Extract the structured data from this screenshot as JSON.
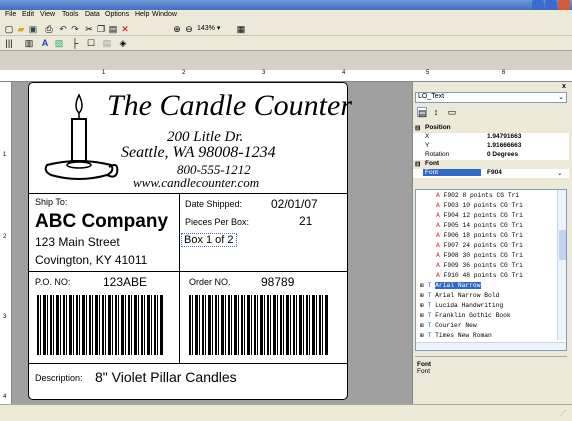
{
  "menu": [
    "File",
    "Edit",
    "View",
    "Tools",
    "Data",
    "Options",
    "Help",
    "Window"
  ],
  "toolbar": {
    "zoom": "143%"
  },
  "ruler": [
    "1",
    "2",
    "3",
    "4",
    "5",
    "6"
  ],
  "ruler_left": [
    "1",
    "2",
    "3",
    "4"
  ],
  "label": {
    "company_line1": "The Candle Counter",
    "address1": "200 Litle Dr.",
    "address2": "Seattle, WA 98008-1234",
    "phone": "800-555-1212",
    "website": "www.candlecounter.com",
    "ship_to_label": "Ship To:",
    "ship_company": "ABC Company",
    "ship_street": "123 Main Street",
    "ship_city": "Covington, KY 41011",
    "date_label": "Date Shipped:",
    "date_value": "02/01/07",
    "pieces_label": "Pieces Per Box:",
    "pieces_value": "21",
    "box_text": "Box 1 of 2",
    "po_label": "P.O. NO:",
    "po_value": "123ABE",
    "order_label": "Order NO.",
    "order_value": "98789",
    "desc_label": "Description:",
    "desc_value": "8\" Violet Pillar Candles"
  },
  "panel": {
    "object": "LO_Text",
    "close": "x",
    "section_position": "Position",
    "x_label": "X",
    "x_value": "1.94791663",
    "y_label": "Y",
    "y_value": "1.91666663",
    "rot_label": "Rotation",
    "rot_value": "0 Degrees",
    "section_font": "Font",
    "font_label": "Font",
    "font_value": "F904",
    "font_items": [
      {
        "code": "F902",
        "size": "8 points",
        "face": "CG Tri"
      },
      {
        "code": "F903",
        "size": "10 points",
        "face": "CG Tri"
      },
      {
        "code": "F904",
        "size": "12 points",
        "face": "CG Tri"
      },
      {
        "code": "F905",
        "size": "14 points",
        "face": "CG Tri"
      },
      {
        "code": "F906",
        "size": "18 points",
        "face": "CG Tri"
      },
      {
        "code": "F907",
        "size": "24 points",
        "face": "CG Tri"
      },
      {
        "code": "F908",
        "size": "30 points",
        "face": "CG Tri"
      },
      {
        "code": "F909",
        "size": "36 points",
        "face": "CG Tri"
      },
      {
        "code": "F910",
        "size": "48 points",
        "face": "CG Tri"
      }
    ],
    "families": [
      "Arial Narrow",
      "Arial Narrow Bold",
      "Lucida Handwriting",
      "Franklin Gothic Book",
      "Courier New",
      "Times New Roman"
    ],
    "desc_title": "Font",
    "desc_text": "Font"
  }
}
